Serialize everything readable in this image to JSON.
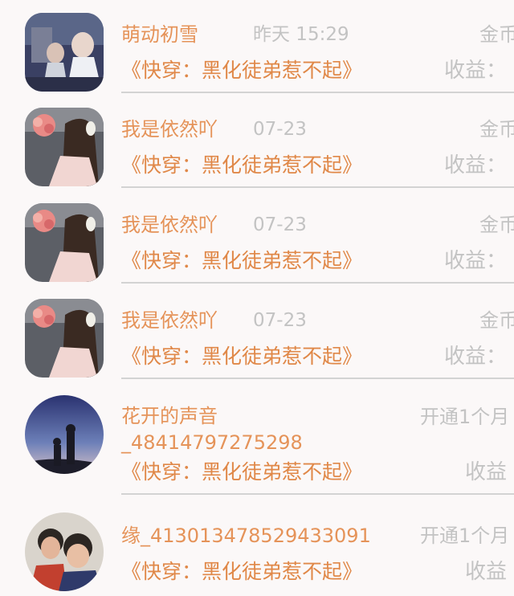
{
  "colors": {
    "accent": "#e59359",
    "muted": "#c3c3c3",
    "divider": "#d3d3d3"
  },
  "items": [
    {
      "avatar": "avatar-image-costume-drama",
      "name": "萌动初雪",
      "date": "昨天 15:29",
      "right_top": "金币",
      "book": "《快穿：黑化徒弟惹不起》",
      "right_bottom": "收益："
    },
    {
      "avatar": "avatar-image-girl-bouquet",
      "name": "我是依然吖",
      "date": "07-23",
      "right_top": "金币",
      "book": "《快穿：黑化徒弟惹不起》",
      "right_bottom": "收益："
    },
    {
      "avatar": "avatar-image-girl-bouquet",
      "name": "我是依然吖",
      "date": "07-23",
      "right_top": "金币",
      "book": "《快穿：黑化徒弟惹不起》",
      "right_bottom": "收益："
    },
    {
      "avatar": "avatar-image-girl-bouquet",
      "name": "我是依然吖",
      "date": "07-23",
      "right_top": "金币",
      "book": "《快穿：黑化徒弟惹不起》",
      "right_bottom": "收益："
    },
    {
      "avatar": "avatar-image-dusk-silhouette",
      "name": "花开的声音_48414797275298",
      "date": "",
      "right_top": "开通1个月",
      "book": "《快穿：黑化徒弟惹不起》",
      "right_bottom": "收益"
    },
    {
      "avatar": "avatar-image-family-photo",
      "name": "缘_413013478529433091",
      "date": "",
      "right_top": "开通1个月",
      "book": "《快穿：黑化徒弟惹不起》",
      "right_bottom": "收益"
    }
  ]
}
